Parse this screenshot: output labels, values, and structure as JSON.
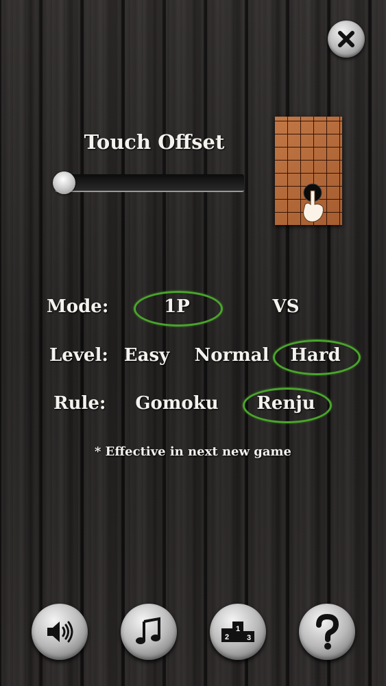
{
  "settings": {
    "touch_offset_title": "Touch Offset",
    "touch_offset_value": 0,
    "mode": {
      "label": "Mode:",
      "options": [
        "1P",
        "VS"
      ],
      "selected": "1P"
    },
    "level": {
      "label": "Level:",
      "options": [
        "Easy",
        "Normal",
        "Hard"
      ],
      "selected": "Hard"
    },
    "rule": {
      "label": "Rule:",
      "options": [
        "Gomoku",
        "Renju"
      ],
      "selected": "Renju"
    },
    "note": "* Effective in next new game"
  },
  "buttons": {
    "close_icon": "close-icon",
    "sound_icon": "speaker-icon",
    "music_icon": "music-note-icon",
    "ranking_icon": "podium-icon",
    "help_icon": "question-icon",
    "podium_numbers": [
      "2",
      "1",
      "3"
    ]
  },
  "colors": {
    "selection_ring": "#49a52b",
    "text": "#f4f2ee",
    "board": "#b66b3c"
  }
}
